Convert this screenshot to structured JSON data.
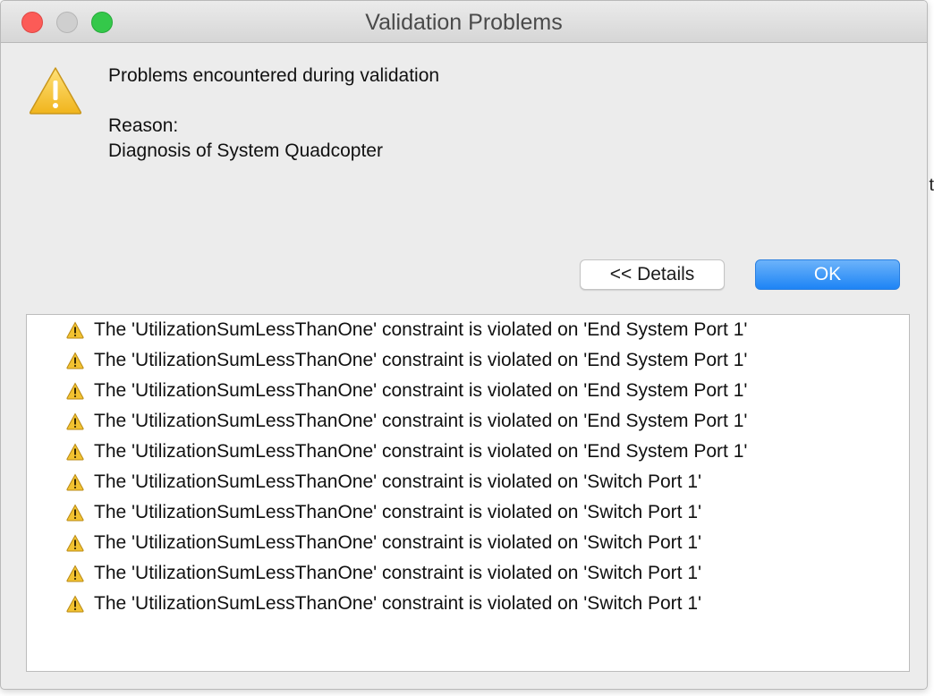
{
  "window": {
    "title": "Validation Problems"
  },
  "dialog": {
    "message": "Problems encountered during validation",
    "reason_label": "Reason:",
    "reason_text": "Diagnosis of System Quadcopter",
    "icon": "warning-icon"
  },
  "buttons": {
    "details_label": "<< Details",
    "ok_label": "OK"
  },
  "details": {
    "items": [
      "The 'UtilizationSumLessThanOne' constraint is violated on 'End System Port 1'",
      "The 'UtilizationSumLessThanOne' constraint is violated on 'End System Port 1'",
      "The 'UtilizationSumLessThanOne' constraint is violated on 'End System Port 1'",
      "The 'UtilizationSumLessThanOne' constraint is violated on 'End System Port 1'",
      "The 'UtilizationSumLessThanOne' constraint is violated on 'End System Port 1'",
      "The 'UtilizationSumLessThanOne' constraint is violated on 'Switch Port 1'",
      "The 'UtilizationSumLessThanOne' constraint is violated on 'Switch Port 1'",
      "The 'UtilizationSumLessThanOne' constraint is violated on 'Switch Port 1'",
      "The 'UtilizationSumLessThanOne' constraint is violated on 'Switch Port 1'",
      "The 'UtilizationSumLessThanOne' constraint is violated on 'Switch Port 1'"
    ]
  },
  "background": {
    "edge_char": "t"
  },
  "colors": {
    "accent": "#1d84f5",
    "warning": "#f2c230",
    "close": "#fc5b57",
    "zoom": "#34c84a"
  }
}
